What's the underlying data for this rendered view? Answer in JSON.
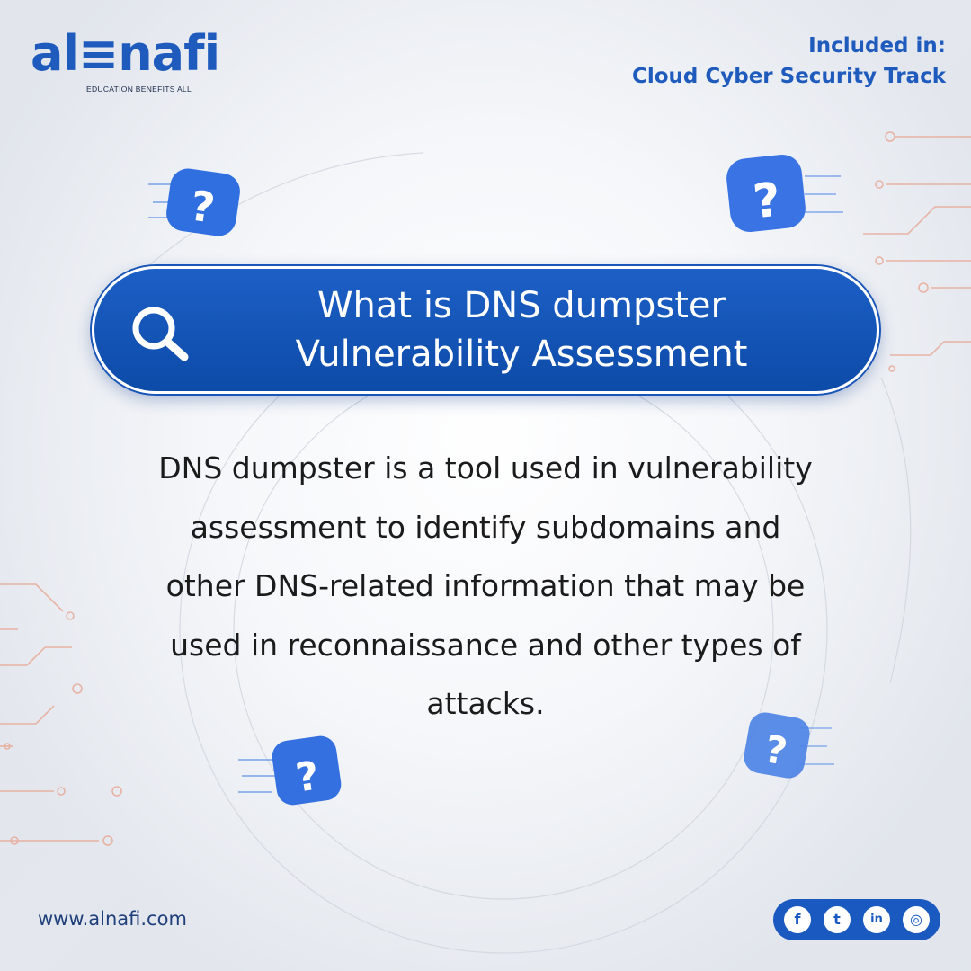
{
  "brand": {
    "logo_text": "al≡nafi",
    "tagline": "EDUCATION BENEFITS ALL",
    "website": "www.alnafi.com"
  },
  "header": {
    "included_line1": "Included in:",
    "included_line2": "Cloud Cyber Security Track"
  },
  "title": {
    "line1": "What is DNS dumpster",
    "line2": "Vulnerability Assessment"
  },
  "body": {
    "lines": [
      "DNS dumpster is a tool used in vulnerability",
      "assessment to identify subdomains and",
      "other DNS-related information that may be",
      "used in reconnaissance and other types of",
      "attacks."
    ]
  },
  "social": {
    "icons": [
      "facebook-icon",
      "twitter-icon",
      "linkedin-icon",
      "instagram-icon"
    ],
    "glyphs": [
      "f",
      "t",
      "in",
      "◎"
    ]
  },
  "colors": {
    "brand_blue": "#1f5bbd",
    "pill_blue": "#0d4ba8",
    "accent_orange": "#e8866a",
    "text_dark": "#1b1b1b"
  }
}
